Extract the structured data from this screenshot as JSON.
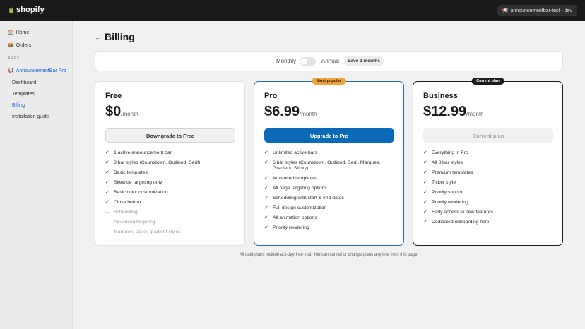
{
  "topbar": {
    "brand": "shopify",
    "store": "announcementbar-test - dev",
    "store_icon": "megaphone-icon"
  },
  "sidebar": {
    "home": "Home",
    "orders": "Orders",
    "apps_label": "APPS",
    "app_name": "AnnouncementBar Pro",
    "items": [
      {
        "label": "Dashboard",
        "active": false
      },
      {
        "label": "Templates",
        "active": false
      },
      {
        "label": "Billing",
        "active": true
      },
      {
        "label": "Installation guide",
        "active": false
      }
    ]
  },
  "page": {
    "back": "←",
    "title": "Billing"
  },
  "billing_toggle": {
    "monthly": "Monthly",
    "annual": "Annual",
    "save": "Save 2 months",
    "annual_enabled": false
  },
  "plans": [
    {
      "name": "Free",
      "price": "$0",
      "period": "/month",
      "button": "Downgrade to Free",
      "features": [
        {
          "text": "1 active announcement bar",
          "mark": "✓"
        },
        {
          "text": "3 bar styles (Countdown, Outlined, Serif)",
          "mark": "✓"
        },
        {
          "text": "Basic templates",
          "mark": "✓"
        },
        {
          "text": "Sitewide targeting only",
          "mark": "✓"
        },
        {
          "text": "Basic color customization",
          "mark": "✓"
        },
        {
          "text": "Close button",
          "mark": "✓"
        },
        {
          "text": "Scheduling",
          "mark": "—"
        },
        {
          "text": "Advanced targeting",
          "mark": "—"
        },
        {
          "text": "Marquee, sticky, gradient styles",
          "mark": "—"
        }
      ]
    },
    {
      "name": "Pro",
      "badge": "Most popular",
      "price": "$6.99",
      "period": "/month",
      "button": "Upgrade to Pro",
      "features": [
        {
          "text": "Unlimited active bars",
          "mark": "✓"
        },
        {
          "text": "6 bar styles (Countdown, Outlined, Serif, Marquee, Gradient, Sticky)",
          "mark": "✓"
        },
        {
          "text": "Advanced templates",
          "mark": "✓"
        },
        {
          "text": "All page targeting options",
          "mark": "✓"
        },
        {
          "text": "Scheduling with start & end dates",
          "mark": "✓"
        },
        {
          "text": "Full design customization",
          "mark": "✓"
        },
        {
          "text": "All animation options",
          "mark": "✓"
        },
        {
          "text": "Priority rendering",
          "mark": "✓"
        }
      ]
    },
    {
      "name": "Business",
      "badge": "Current plan",
      "price": "$12.99",
      "period": "/month",
      "button": "Current plan",
      "features": [
        {
          "text": "Everything in Pro",
          "mark": "✓"
        },
        {
          "text": "All 8 bar styles",
          "mark": "✓"
        },
        {
          "text": "Premium templates",
          "mark": "✓"
        },
        {
          "text": "Ticker style",
          "mark": "✓"
        },
        {
          "text": "Priority support",
          "mark": "✓"
        },
        {
          "text": "Priority rendering",
          "mark": "✓"
        },
        {
          "text": "Early access to new features",
          "mark": "✓"
        },
        {
          "text": "Dedicated onboarding help",
          "mark": "✓"
        }
      ]
    }
  ],
  "footnote": "All paid plans include a 3-day free trial. You can cancel or change plans anytime from this page.",
  "colors": {
    "topbar": "#1a1a1a",
    "accent": "#005bd3",
    "upgrade_button": "#0a6ab8",
    "popular_badge": "#f0a13a",
    "pro_border": "#1f6ea8"
  }
}
